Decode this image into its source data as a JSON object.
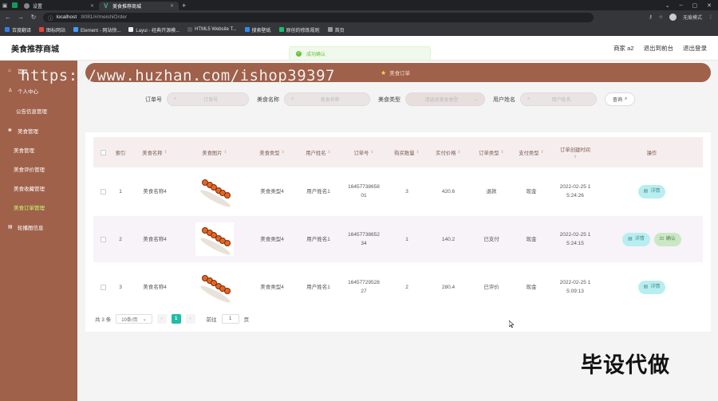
{
  "browser": {
    "tabs": [
      {
        "label": "",
        "icon": "app-icon"
      },
      {
        "label": "",
        "icon": "green-app-icon"
      },
      {
        "label": "设置",
        "icon": "settings-icon"
      },
      {
        "label": "美食推荐商城",
        "icon": "vue-icon"
      }
    ],
    "url_host": "localhost",
    "url_path": ":8081/#/meishiOrder",
    "profile_label": "无痕模式",
    "bookmarks": [
      "百度翻译",
      "图标网站",
      "Element - 网站快...",
      "Layui - 经典开源模...",
      "HTML5 Website T...",
      "搜索壁纸",
      "原创的修炼规则",
      "首页"
    ]
  },
  "app": {
    "title": "美食推荐商城",
    "header_links": [
      "商家 a2",
      "退出到前台",
      "退出登录"
    ],
    "toast": "成功确认"
  },
  "sidebar": {
    "items": [
      {
        "label": "首页",
        "icon": "home-icon"
      },
      {
        "label": "个人中心",
        "icon": "user-icon"
      },
      {
        "label": "公告信息管理",
        "icon": ""
      },
      {
        "label": "美食管理",
        "icon": "food-icon"
      }
    ],
    "subitems": [
      "美食管理",
      "美食评价管理",
      "美食收藏管理",
      "美食订单管理"
    ],
    "bottom_item": {
      "label": "轮播图信息",
      "icon": "image-icon"
    }
  },
  "breadcrumb": {
    "text": "美食订单"
  },
  "search": {
    "order_label": "订单号",
    "order_placeholder": "订单号",
    "name_label": "美食名称",
    "name_placeholder": "美食名称",
    "type_label": "美食类型",
    "type_placeholder": "请选择美食类型",
    "user_label": "用户姓名",
    "user_placeholder": "用户姓名",
    "query_label": "查询"
  },
  "table": {
    "headers": [
      "索引",
      "美食名称",
      "美食图片",
      "美食类型",
      "用户姓名",
      "订单号",
      "购买数量",
      "实付价格",
      "订单类型",
      "支付类型",
      "订单创建时间",
      "操作"
    ],
    "rows": [
      {
        "index": "1",
        "name": "美食名称4",
        "type": "美食类型4",
        "user": "用户姓名1",
        "order_a": "16457738658",
        "order_b": "01",
        "qty": "3",
        "price": "420.6",
        "status": "退款",
        "pay": "现金",
        "time_a": "2022-02-25 1",
        "time_b": "5:24:26",
        "actions": [
          "详情"
        ]
      },
      {
        "index": "2",
        "name": "美食名称4",
        "type": "美食类型4",
        "user": "用户姓名1",
        "order_a": "16457738652",
        "order_b": "34",
        "qty": "1",
        "price": "140.2",
        "status": "已支付",
        "pay": "现金",
        "time_a": "2022-02-25 1",
        "time_b": "5:24:15",
        "actions": [
          "详情",
          "确认"
        ]
      },
      {
        "index": "3",
        "name": "美食名称4",
        "type": "美食类型4",
        "user": "用户姓名1",
        "order_a": "16457729528",
        "order_b": "27",
        "qty": "2",
        "price": "280.4",
        "status": "已评价",
        "pay": "现金",
        "time_a": "2022-02-25 1",
        "time_b": "5:09:13",
        "actions": [
          "详情"
        ]
      }
    ]
  },
  "pager": {
    "total": "共 3 条",
    "page_size": "10条/页",
    "current": "1",
    "goto_label": "前往",
    "goto_value": "1",
    "page_suffix": "页"
  },
  "watermark": {
    "url": "https://www.huzhan.com/ishop39397",
    "caption": "毕设代做"
  },
  "colors": {
    "sidebar": "#a0614b",
    "accent": "#21bda3",
    "submenu_active": "#c6ff6b"
  }
}
